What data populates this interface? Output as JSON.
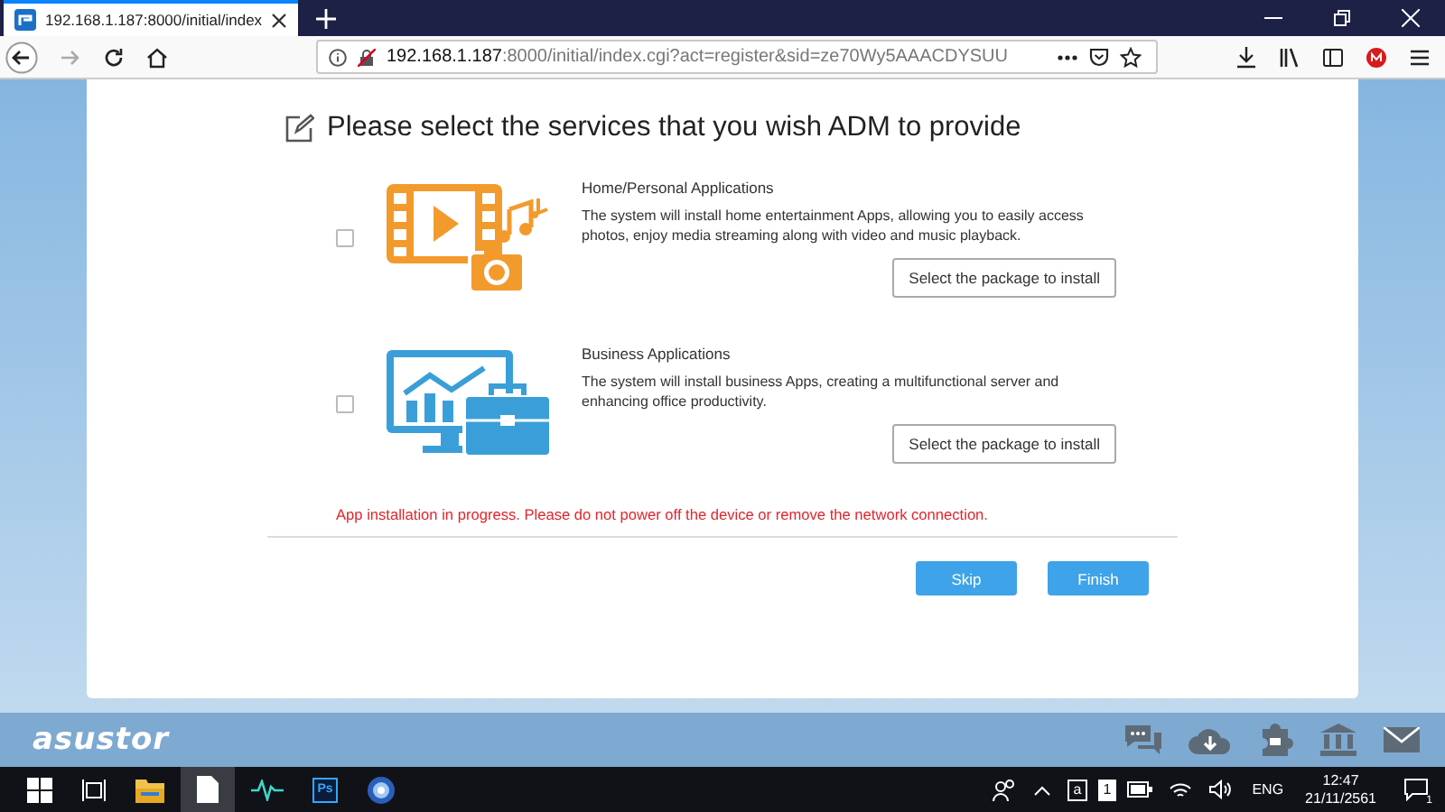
{
  "browser": {
    "tab": {
      "title": "192.168.1.187:8000/initial/index",
      "selected": true
    },
    "url_host": "192.168.1.187",
    "url_rest": ":8000/initial/index.cgi?act=register&sid=ze70Wy5AAACDYSUU"
  },
  "dialog": {
    "title": "Please select the services that you wish ADM to provide",
    "services": [
      {
        "kind": "home",
        "title": "Home/Personal Applications",
        "description": "The system will install home entertainment Apps, allowing you to easily access photos, enjoy media streaming along with video and music playback.",
        "checked": false,
        "button": "Select the package to install"
      },
      {
        "kind": "business",
        "title": "Business Applications",
        "description": "The system will install business Apps, creating a multifunctional server and enhancing office productivity.",
        "checked": false,
        "button": "Select the package to install"
      }
    ],
    "warning": "App installation in progress. Please do not power off the device or remove the network connection.",
    "buttons": [
      {
        "label": "Skip"
      },
      {
        "label": "Finish"
      }
    ]
  },
  "brand": "asustor",
  "taskbar": {
    "ps_label": "Ps",
    "tray_keys": [
      "a",
      "1"
    ],
    "language": "ENG",
    "time": "12:47",
    "date": "21/11/2561",
    "notification_count": "1"
  }
}
